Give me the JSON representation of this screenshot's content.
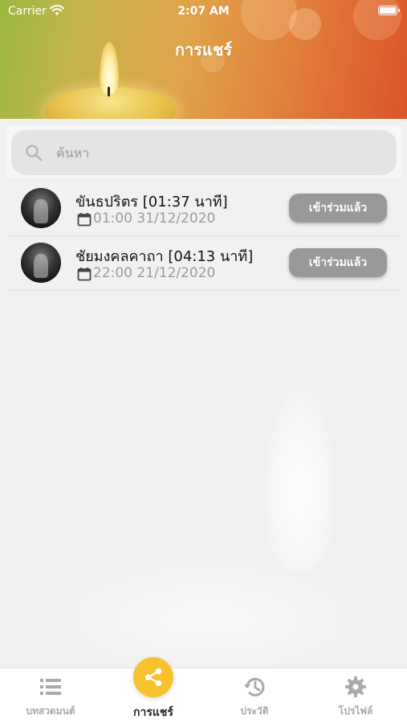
{
  "status_bar": {
    "carrier": "Carrier",
    "time": "2:07 AM"
  },
  "header": {
    "title": "การแชร์"
  },
  "search": {
    "placeholder": "ค้นหา"
  },
  "sessions": [
    {
      "title": "ขันธปริตร [01:37 นาที]",
      "datetime": "01:00 31/12/2020",
      "button_label": "เข้าร่วมแล้ว"
    },
    {
      "title": "ชัยมงคลคาถา [04:13 นาที]",
      "datetime": "22:00 21/12/2020",
      "button_label": "เข้าร่วมแล้ว"
    }
  ],
  "tabs": [
    {
      "label": "บทสวดมนต์",
      "icon": "list-icon",
      "active": false
    },
    {
      "label": "การแชร์",
      "icon": "share-icon",
      "active": true
    },
    {
      "label": "ประวัติ",
      "icon": "history-icon",
      "active": false
    },
    {
      "label": "โปรไฟล์",
      "icon": "gear-icon",
      "active": false
    }
  ],
  "colors": {
    "accent": "#f7c22b",
    "button": "#999999",
    "header_start": "#9cb93f",
    "header_end": "#d9552a"
  }
}
